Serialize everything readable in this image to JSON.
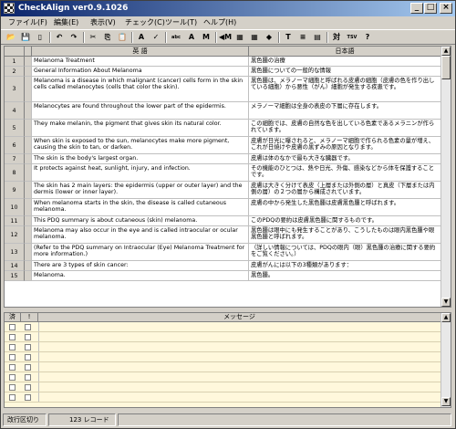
{
  "window": {
    "title": "CheckAlign ver0.9.1026",
    "icon": "checkerboard-app-icon",
    "controls": [
      "_",
      "□",
      "×"
    ]
  },
  "menu": [
    "ファイル(F)",
    "編集(E)",
    "表示(V)",
    "チェック(C)",
    "ツール(T)",
    "ヘルプ(H)"
  ],
  "toolbar": [
    {
      "icon": "open-folder-icon",
      "glyph": "📂"
    },
    {
      "icon": "save-icon",
      "glyph": "💾"
    },
    {
      "icon": "new-document-icon",
      "glyph": "▯"
    },
    {
      "icon": "undo-icon",
      "glyph": "↶"
    },
    {
      "icon": "redo-icon",
      "glyph": "↷"
    },
    {
      "icon": "cut-icon",
      "glyph": "✂"
    },
    {
      "icon": "copy-icon",
      "glyph": "⎘"
    },
    {
      "icon": "paste-icon",
      "glyph": "📋"
    },
    {
      "icon": "find-replace-icon",
      "glyph": "A"
    },
    {
      "icon": "mark-icon",
      "glyph": "✓"
    },
    {
      "icon": "check-abc-icon",
      "glyph": "abc"
    },
    {
      "icon": "check-all-icon",
      "glyph": "A"
    },
    {
      "icon": "merge-down-icon",
      "glyph": "M"
    },
    {
      "icon": "merge-up-icon",
      "glyph": "◀M"
    },
    {
      "icon": "table-icon",
      "glyph": "▦"
    },
    {
      "icon": "grid-icon",
      "glyph": "▦"
    },
    {
      "icon": "tag-icon",
      "glyph": "◆"
    },
    {
      "icon": "text-icon",
      "glyph": "T"
    },
    {
      "icon": "align-icon",
      "glyph": "≡"
    },
    {
      "icon": "columns-icon",
      "glyph": "▤"
    },
    {
      "icon": "export-txt-icon",
      "glyph": "対"
    },
    {
      "icon": "export-tsv-icon",
      "glyph": "TSV"
    },
    {
      "icon": "help-icon",
      "glyph": "?"
    }
  ],
  "grid": {
    "headers": {
      "english": "英 語",
      "japanese": "日本語"
    },
    "rows": [
      {
        "num": "1",
        "en": "Melanoma Treatment",
        "ja": "黒色腫の治療"
      },
      {
        "num": "2",
        "en": "General Information About Melanoma",
        "ja": "黒色腫についての一般的な情報"
      },
      {
        "num": "3",
        "en": "Melanoma is a disease in which malignant (cancer) cells form in the skin cells called melanocytes (cells that color the skin).",
        "ja": "黒色腫は、メラノーマ細胞と呼ばれる皮膚の細胞（皮膚の色を作り出している細胞）から悪性（がん）細胞が発生する疾患です。"
      },
      {
        "num": "4",
        "en": "Melanocytes are found throughout the lower part of the epidermis.",
        "ja": "メラノーマ細胞は全身の表皮の下層に存在します。"
      },
      {
        "num": "5",
        "en": "They make melanin, the pigment that gives skin its natural color.",
        "ja": "この細胞では、皮膚の自然な色を出している色素であるメラニンが作られています。"
      },
      {
        "num": "6",
        "en": "When skin is exposed to the sun, melanocytes make more pigment, causing the skin to tan, or darken.",
        "ja": "皮膚が日光に曝されると、メラノーマ細胞で作られる色素の量が増え、これが日焼けや皮膚の黒ずみの原因となります。"
      },
      {
        "num": "7",
        "en": "The skin is the body's largest organ.",
        "ja": "皮膚は体のなかで最も大きな臓器です。"
      },
      {
        "num": "8",
        "en": "It protects against heat, sunlight, injury, and infection.",
        "ja": "その機能のひとつは、熱や日光、外傷、感染などから体を保護することです。"
      },
      {
        "num": "9",
        "en": "The skin has 2 main layers: the epidermis (upper or outer layer) and the dermis (lower or inner layer).",
        "ja": "皮膚は大きく分けて表皮（上層または外側の層）と真皮（下層または内側の層）の２つの層から構成されています。"
      },
      {
        "num": "10",
        "en": "When melanoma starts in the skin, the disease is called cutaneous melanoma.",
        "ja": "皮膚の中から発生した黒色腫は皮膚黒色腫と呼ばれます。"
      },
      {
        "num": "11",
        "en": "This PDQ summary is about cutaneous (skin) melanoma.",
        "ja": "このPDQの要約は皮膚黒色腫に関するものです。"
      },
      {
        "num": "12",
        "en": "Melanoma may also occur in the eye and is called intraocular or ocular melanoma.",
        "ja": "黒色腫は眼中にも発生することがあり、こうしたものは眼内黒色腫や眼黒色腫と呼ばれます。"
      },
      {
        "num": "13",
        "en": "(Refer to the PDQ summary on Intraocular (Eye) Melanoma Treatment for more information.)",
        "ja": "（詳しい情報については、PDQの眼内（眼）黒色腫の治療に関する要約をご覧ください。）"
      },
      {
        "num": "14",
        "en": "There are 3 types of skin cancer:",
        "ja": "皮膚がんには以下の3種類があります："
      },
      {
        "num": "15",
        "en": "Melanoma.",
        "ja": "黒色腫。"
      }
    ]
  },
  "messages": {
    "headers": {
      "done": "済",
      "flag": "!",
      "message": "メッセージ"
    }
  },
  "status": {
    "linebreak": "改行区切り",
    "records": "123 レコード"
  }
}
